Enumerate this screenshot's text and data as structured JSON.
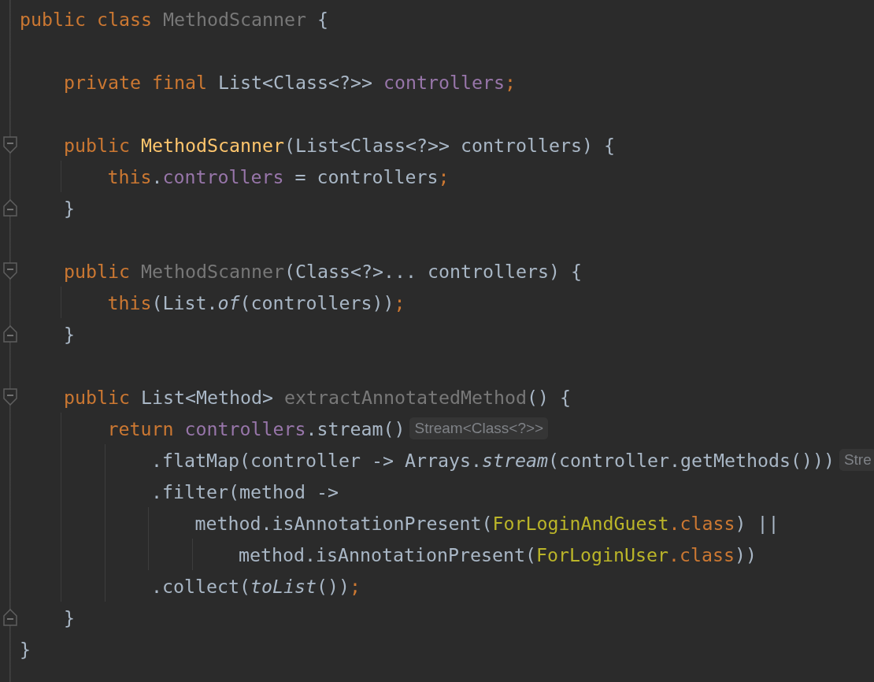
{
  "editor": {
    "lines": [
      {
        "fold_start": false,
        "fold_end": false,
        "tokens": [
          {
            "text": "public class ",
            "kind": "keyword"
          },
          {
            "text": "MethodScanner",
            "kind": "unused"
          },
          {
            "text": " {",
            "kind": "plain"
          }
        ]
      },
      {
        "fold_start": false,
        "fold_end": false
      },
      {
        "fold_start": false,
        "fold_end": false,
        "tokens": [
          {
            "text": "    private final ",
            "kind": "keyword"
          },
          {
            "text": "List<Class<?>> ",
            "kind": "plain"
          },
          {
            "text": "controllers",
            "kind": "field"
          },
          {
            "text": ";",
            "kind": "keyword"
          }
        ]
      },
      {
        "fold_start": false,
        "fold_end": false
      },
      {
        "fold_start": true,
        "fold_end": false,
        "tokens": [
          {
            "text": "    public ",
            "kind": "keyword"
          },
          {
            "text": "MethodScanner",
            "kind": "declaration"
          },
          {
            "text": "(List<Class<?>> controllers) {",
            "kind": "plain"
          }
        ]
      },
      {
        "fold_start": false,
        "fold_end": false,
        "tokens": [
          {
            "text": "        this",
            "kind": "keyword"
          },
          {
            "text": ".",
            "kind": "plain"
          },
          {
            "text": "controllers",
            "kind": "field"
          },
          {
            "text": " = controllers",
            "kind": "plain"
          },
          {
            "text": ";",
            "kind": "keyword"
          }
        ]
      },
      {
        "fold_start": false,
        "fold_end": true,
        "tokens": [
          {
            "text": "    }",
            "kind": "plain"
          }
        ]
      },
      {
        "fold_start": false,
        "fold_end": false
      },
      {
        "fold_start": true,
        "fold_end": false,
        "tokens": [
          {
            "text": "    public ",
            "kind": "keyword"
          },
          {
            "text": "MethodScanner",
            "kind": "unused"
          },
          {
            "text": "(Class<?>... controllers) {",
            "kind": "plain"
          }
        ]
      },
      {
        "fold_start": false,
        "fold_end": false,
        "tokens": [
          {
            "text": "        this",
            "kind": "keyword"
          },
          {
            "text": "(List.",
            "kind": "plain"
          },
          {
            "text": "of",
            "kind": "static"
          },
          {
            "text": "(controllers))",
            "kind": "plain"
          },
          {
            "text": ";",
            "kind": "keyword"
          }
        ]
      },
      {
        "fold_start": false,
        "fold_end": true,
        "tokens": [
          {
            "text": "    }",
            "kind": "plain"
          }
        ]
      },
      {
        "fold_start": false,
        "fold_end": false
      },
      {
        "fold_start": true,
        "fold_end": false,
        "tokens": [
          {
            "text": "    public ",
            "kind": "keyword"
          },
          {
            "text": "List<Method> ",
            "kind": "plain"
          },
          {
            "text": "extractAnnotatedMethod",
            "kind": "unused"
          },
          {
            "text": "() {",
            "kind": "plain"
          }
        ]
      },
      {
        "fold_start": false,
        "fold_end": false,
        "tokens": [
          {
            "text": "        return ",
            "kind": "keyword"
          },
          {
            "text": "controllers",
            "kind": "field"
          },
          {
            "text": ".stream()",
            "kind": "plain"
          },
          {
            "text": "Stream<Class<?>>",
            "kind": "hint"
          }
        ]
      },
      {
        "fold_start": false,
        "fold_end": false,
        "tokens": [
          {
            "text": "            .flatMap(controller -> Arrays.",
            "kind": "plain"
          },
          {
            "text": "stream",
            "kind": "static"
          },
          {
            "text": "(controller.getMethods()))",
            "kind": "plain"
          },
          {
            "text": "Stre",
            "kind": "hint"
          }
        ]
      },
      {
        "fold_start": false,
        "fold_end": false,
        "tokens": [
          {
            "text": "            .filter(method ->",
            "kind": "plain"
          }
        ]
      },
      {
        "fold_start": false,
        "fold_end": false,
        "tokens": [
          {
            "text": "                method.isAnnotationPresent(",
            "kind": "plain"
          },
          {
            "text": "ForLoginAndGuest",
            "kind": "annotation"
          },
          {
            "text": ".class",
            "kind": "keyword"
          },
          {
            "text": ") ||",
            "kind": "plain"
          }
        ]
      },
      {
        "fold_start": false,
        "fold_end": false,
        "tokens": [
          {
            "text": "                    method.isAnnotationPresent(",
            "kind": "plain"
          },
          {
            "text": "ForLoginUser",
            "kind": "annotation"
          },
          {
            "text": ".class",
            "kind": "keyword"
          },
          {
            "text": "))",
            "kind": "plain"
          }
        ]
      },
      {
        "fold_start": false,
        "fold_end": false,
        "tokens": [
          {
            "text": "            .collect(",
            "kind": "plain"
          },
          {
            "text": "toList",
            "kind": "static"
          },
          {
            "text": "())",
            "kind": "plain"
          },
          {
            "text": ";",
            "kind": "keyword"
          }
        ]
      },
      {
        "fold_start": false,
        "fold_end": true,
        "tokens": [
          {
            "text": "    }",
            "kind": "plain"
          }
        ]
      },
      {
        "fold_start": false,
        "fold_end": false,
        "tokens": [
          {
            "text": "}",
            "kind": "plain"
          }
        ]
      }
    ]
  }
}
